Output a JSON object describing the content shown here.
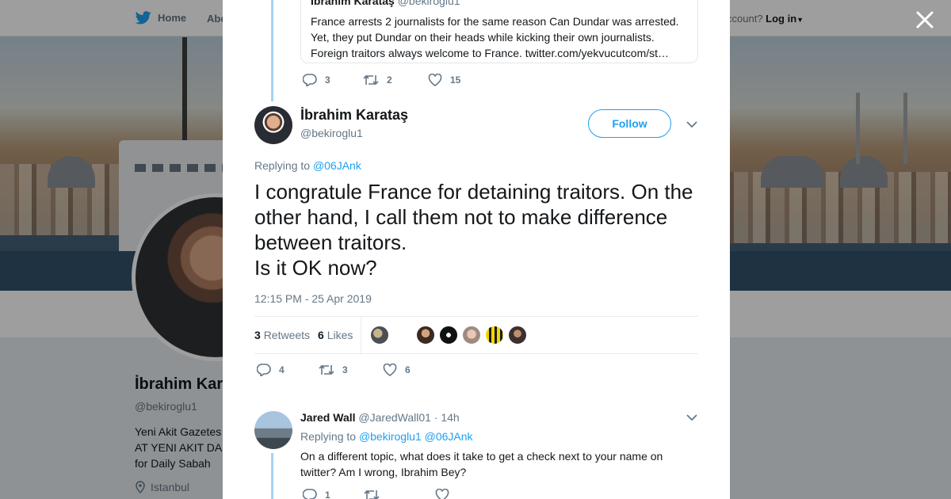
{
  "nav": {
    "home_label": "Home",
    "about_label": "Abo",
    "account_prompt": "ccount?",
    "login_label": "Log in"
  },
  "profile": {
    "name": "İbrahim Kar",
    "handle": "@bekiroglu1",
    "bio_lines": [
      "Yeni Akit Gazetes",
      "AT YENI AKIT DA",
      "for Daily Sabah"
    ],
    "location": "Istanbul"
  },
  "quoted_tweet": {
    "author": "İbrahim Karataş",
    "handle": "@bekiroglu1",
    "text": "France arrests 2 journalists for the same reason Can Dundar was arrested. Yet, they put Dundar on their heads while kicking their own journalists. Foreign traitors always welcome to France. twitter.com/yekvucutcom/st…",
    "replies": "3",
    "retweets": "2",
    "likes": "15"
  },
  "main_tweet": {
    "author": "İbrahim Karataş",
    "handle": "@bekiroglu1",
    "follow_label": "Follow",
    "replying_prefix": "Replying to",
    "replying_to": "@06JAnk",
    "text": "I congratule France for detaining traitors. On the other hand, I call them not to make difference between traitors.\nIs it OK now?",
    "timestamp": "12:15 PM - 25 Apr 2019",
    "retweet_count": "3",
    "retweet_label": "Retweets",
    "like_count": "6",
    "like_label": "Likes",
    "replies": "4",
    "retweets": "3",
    "likes": "6"
  },
  "reply": {
    "author": "Jared Wall",
    "handle": "@JaredWall01",
    "time": "· 14h",
    "replying_prefix": "Replying to",
    "replying_to_1": "@bekiroglu1",
    "replying_to_2": "@06JAnk",
    "text": "On a different topic, what does it take to get a check next to your name on twitter? Am I wrong, Ibrahim Bey?",
    "replies": "1"
  },
  "colors": {
    "accent": "#1da1f2",
    "muted": "#657786",
    "text": "#14171a",
    "thread": "#a5d3f2"
  }
}
